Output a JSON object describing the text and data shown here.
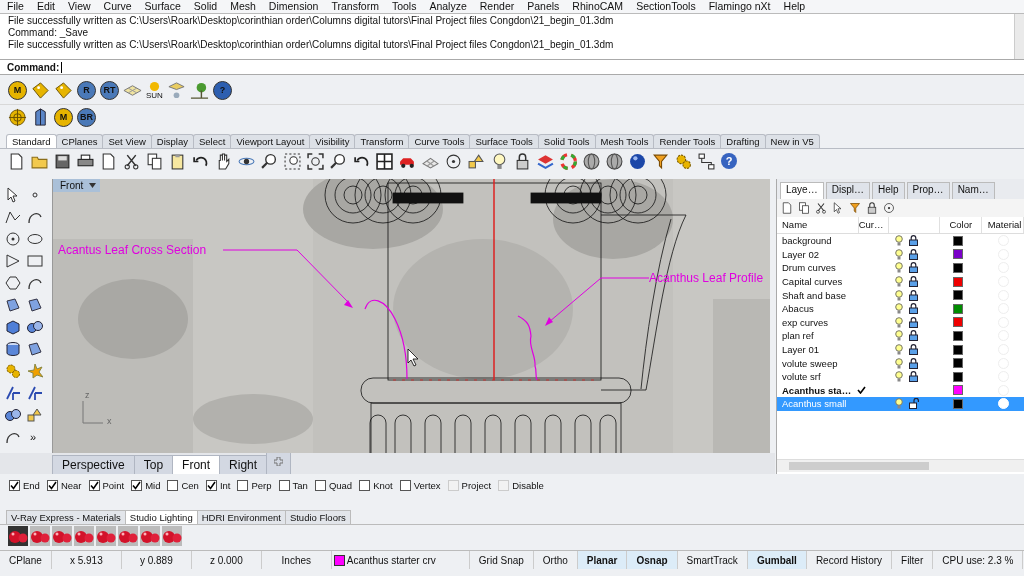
{
  "menu_bar": [
    "File",
    "Edit",
    "View",
    "Curve",
    "Surface",
    "Solid",
    "Mesh",
    "Dimension",
    "Transform",
    "Tools",
    "Analyze",
    "Render",
    "Panels",
    "RhinoCAM",
    "SectionTools",
    "Flamingo nXt",
    "Help"
  ],
  "command_history": [
    "File successfully written as C:\\Users\\Roark\\Desktop\\corinthian order\\Columns digital tutors\\Final Project files Congdon\\21_begin_01.3dm",
    "Command: _Save",
    "File successfully written as C:\\Users\\Roark\\Desktop\\corinthian order\\Columns digital tutors\\Final Project files Congdon\\21_begin_01.3dm"
  ],
  "command_prompt": {
    "label": "Command:"
  },
  "toolbar_row_1": [
    {
      "kind": "badge",
      "label": "M",
      "color": "#e6b400"
    },
    {
      "kind": "tag"
    },
    {
      "kind": "tag"
    },
    {
      "kind": "badge",
      "label": "R",
      "color": "#4a79b8"
    },
    {
      "kind": "badge",
      "label": "RT",
      "color": "#4a79b8"
    },
    {
      "kind": "plane"
    },
    {
      "kind": "sun",
      "label": "SUN"
    },
    {
      "kind": "lamp"
    },
    {
      "kind": "tree"
    },
    {
      "kind": "badge",
      "label": "?",
      "color": "#2d5fb0"
    }
  ],
  "toolbar_row_2": [
    {
      "kind": "target"
    },
    {
      "kind": "building"
    },
    {
      "kind": "badge",
      "label": "M",
      "color": "#e6b400"
    },
    {
      "kind": "badge",
      "label": "BR",
      "color": "#4a79b8"
    }
  ],
  "toolbar_tabs": [
    {
      "label": "Standard",
      "selected": true
    },
    {
      "label": "CPlanes",
      "selected": false
    },
    {
      "label": "Set View",
      "selected": false
    },
    {
      "label": "Display",
      "selected": false
    },
    {
      "label": "Select",
      "selected": false
    },
    {
      "label": "Viewport Layout",
      "selected": false
    },
    {
      "label": "Visibility",
      "selected": false
    },
    {
      "label": "Transform",
      "selected": false
    },
    {
      "label": "Curve Tools",
      "selected": false
    },
    {
      "label": "Surface Tools",
      "selected": false
    },
    {
      "label": "Solid Tools",
      "selected": false
    },
    {
      "label": "Mesh Tools",
      "selected": false
    },
    {
      "label": "Render Tools",
      "selected": false
    },
    {
      "label": "Drafting",
      "selected": false
    },
    {
      "label": "New in V5",
      "selected": false
    }
  ],
  "standard_toolbar": {
    "help_label": "?"
  },
  "left_toolbar": {
    "more_label": "»"
  },
  "viewport": {
    "title": "Front",
    "annotations": [
      "Acantus Leaf Cross Section",
      "Acanthus Leaf Profile"
    ],
    "axis_labels": [
      "z",
      "x"
    ]
  },
  "viewport_tabs": [
    {
      "label": "Perspective",
      "selected": false
    },
    {
      "label": "Top",
      "selected": false
    },
    {
      "label": "Front",
      "selected": true
    },
    {
      "label": "Right",
      "selected": false
    }
  ],
  "layers_panel": {
    "tabs": [
      {
        "label": "Laye…",
        "selected": true
      },
      {
        "label": "Displ…",
        "selected": false
      },
      {
        "label": "Help",
        "selected": false
      },
      {
        "label": "Prop…",
        "selected": false
      },
      {
        "label": "Nam…",
        "selected": false
      }
    ],
    "columns": [
      "Name",
      "Cur…",
      "Color",
      "Material"
    ],
    "layers": [
      {
        "name": "background",
        "current": false,
        "locked": true,
        "selected": false,
        "color": "#000000"
      },
      {
        "name": "Layer 02",
        "current": false,
        "locked": true,
        "selected": false,
        "color": "#7a00c8"
      },
      {
        "name": "Drum curves",
        "current": false,
        "locked": true,
        "selected": false,
        "color": "#000000"
      },
      {
        "name": "Capital curves",
        "current": false,
        "locked": true,
        "selected": false,
        "color": "#ee0000"
      },
      {
        "name": "Shaft and base",
        "current": false,
        "locked": true,
        "selected": false,
        "color": "#000000"
      },
      {
        "name": "Abacus",
        "current": false,
        "locked": true,
        "selected": false,
        "color": "#008c00"
      },
      {
        "name": "exp curves",
        "current": false,
        "locked": true,
        "selected": false,
        "color": "#ee0000"
      },
      {
        "name": "plan ref",
        "current": false,
        "locked": true,
        "selected": false,
        "color": "#000000"
      },
      {
        "name": "Layer 01",
        "current": false,
        "locked": true,
        "selected": false,
        "color": "#000000"
      },
      {
        "name": "volute sweep",
        "current": false,
        "locked": true,
        "selected": false,
        "color": "#000000"
      },
      {
        "name": "volute srf",
        "current": false,
        "locked": true,
        "selected": false,
        "color": "#000000"
      },
      {
        "name": "Acanthus sta…",
        "current": true,
        "selected": false,
        "color": "#ff00ff"
      },
      {
        "name": "Acanthus small",
        "current": false,
        "locked": false,
        "selected": true,
        "color": "#000000"
      }
    ]
  },
  "osnaps": [
    {
      "label": "End",
      "checked": true,
      "disabled": false
    },
    {
      "label": "Near",
      "checked": true,
      "disabled": false
    },
    {
      "label": "Point",
      "checked": true,
      "disabled": false
    },
    {
      "label": "Mid",
      "checked": true,
      "disabled": false
    },
    {
      "label": "Cen",
      "checked": false,
      "disabled": false
    },
    {
      "label": "Int",
      "checked": true,
      "disabled": false
    },
    {
      "label": "Perp",
      "checked": false,
      "disabled": false
    },
    {
      "label": "Tan",
      "checked": false,
      "disabled": false
    },
    {
      "label": "Quad",
      "checked": false,
      "disabled": false
    },
    {
      "label": "Knot",
      "checked": false,
      "disabled": false
    },
    {
      "label": "Vertex",
      "checked": false,
      "disabled": false
    },
    {
      "label": "Project",
      "checked": false,
      "disabled": true
    },
    {
      "label": "Disable",
      "checked": false,
      "disabled": true
    }
  ],
  "render_tabs": [
    {
      "label": "V-Ray Express - Materials",
      "selected": false
    },
    {
      "label": "Studio Lighting",
      "selected": true
    },
    {
      "label": "HDRI Environment",
      "selected": false
    },
    {
      "label": "Studio Floors",
      "selected": false
    }
  ],
  "status_bar": [
    {
      "kind": "plain",
      "text": "CPlane"
    },
    {
      "kind": "coordinate",
      "text": "x 5.913"
    },
    {
      "kind": "coordinate",
      "text": "y 0.889"
    },
    {
      "kind": "coordinate",
      "text": "z 0.000"
    },
    {
      "kind": "coordinate",
      "text": "Inches"
    },
    {
      "kind": "layer",
      "text": "Acanthus starter crv",
      "color": "#ff00ff"
    },
    {
      "kind": "toggle",
      "text": "Grid Snap",
      "on": false
    },
    {
      "kind": "toggle",
      "text": "Ortho",
      "on": false
    },
    {
      "kind": "toggle",
      "text": "Planar",
      "on": true
    },
    {
      "kind": "toggle",
      "text": "Osnap",
      "on": true
    },
    {
      "kind": "toggle",
      "text": "SmartTrack",
      "on": false
    },
    {
      "kind": "toggle",
      "text": "Gumball",
      "on": true
    },
    {
      "kind": "toggle",
      "text": "Record History",
      "on": false
    },
    {
      "kind": "toggle",
      "text": "Filter",
      "on": false
    },
    {
      "kind": "plain",
      "text": "CPU use: 2.3 %"
    }
  ]
}
